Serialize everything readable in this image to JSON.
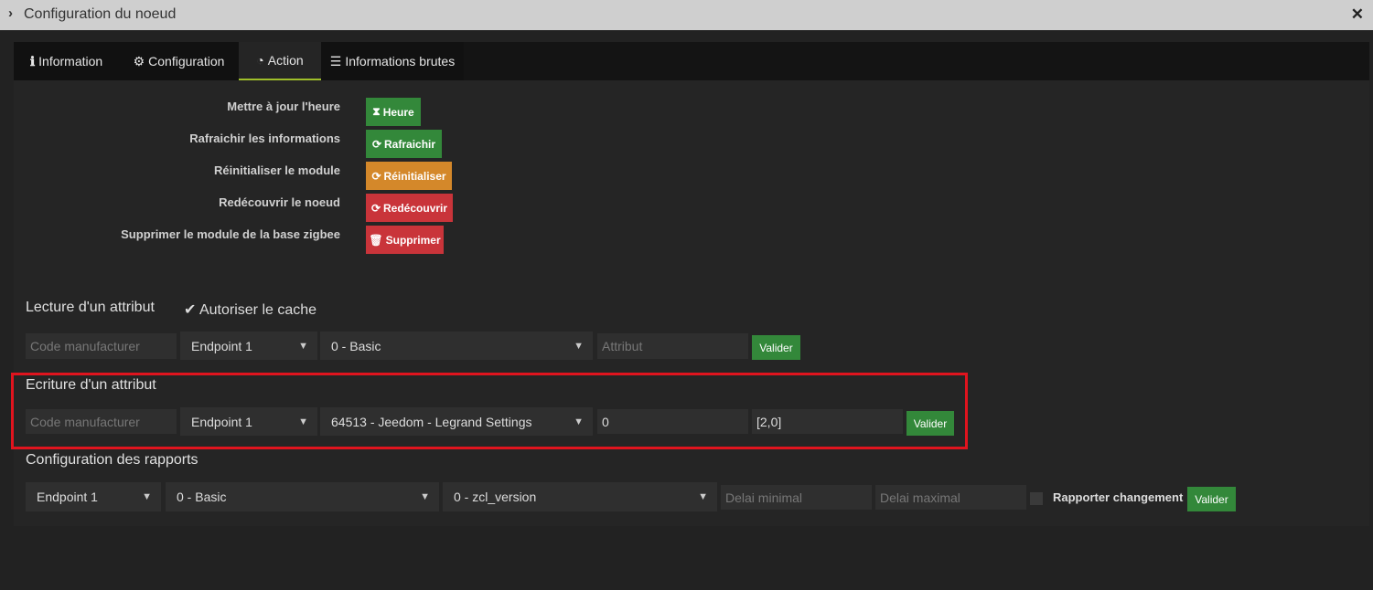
{
  "title": "Configuration du noeud",
  "tabs": [
    {
      "label": "Information",
      "icon": "info-icon"
    },
    {
      "label": "Configuration",
      "icon": "gear-icon"
    },
    {
      "label": "Action",
      "icon": "dashboard-icon"
    },
    {
      "label": "Informations brutes",
      "icon": "list-icon"
    }
  ],
  "actions": [
    {
      "label": "Mettre à jour l'heure",
      "button": "Heure",
      "color": "#33883a"
    },
    {
      "label": "Rafraichir les informations",
      "button": "Rafraichir",
      "color": "#33883a"
    },
    {
      "label": "Réinitialiser le module",
      "button": "Réinitialiser",
      "color": "#d4882a"
    },
    {
      "label": "Redécouvrir le noeud",
      "button": "Redécouvrir",
      "color": "#c9343a"
    },
    {
      "label": "Supprimer le module de la base zigbee",
      "button": "Supprimer",
      "color": "#c9343a"
    }
  ],
  "read": {
    "title": "Lecture d'un attribut",
    "cache_label": "Autoriser le cache",
    "cache_checked": true,
    "manufacturer_placeholder": "Code manufacturer",
    "endpoint": "Endpoint 1",
    "cluster": "0 - Basic",
    "attribute_placeholder": "Attribut",
    "submit": "Valider"
  },
  "write": {
    "title": "Ecriture d'un attribut",
    "manufacturer_placeholder": "Code manufacturer",
    "endpoint": "Endpoint 1",
    "cluster": "64513 - Jeedom - Legrand Settings",
    "attribute": "0",
    "value": "[2,0]",
    "submit": "Valider"
  },
  "report": {
    "title": "Configuration des rapports",
    "endpoint": "Endpoint 1",
    "cluster": "0 - Basic",
    "attribute": "0 - zcl_version",
    "min_placeholder": "Delai minimal",
    "max_placeholder": "Delai maximal",
    "change_label": "Rapporter changement",
    "submit": "Valider"
  }
}
